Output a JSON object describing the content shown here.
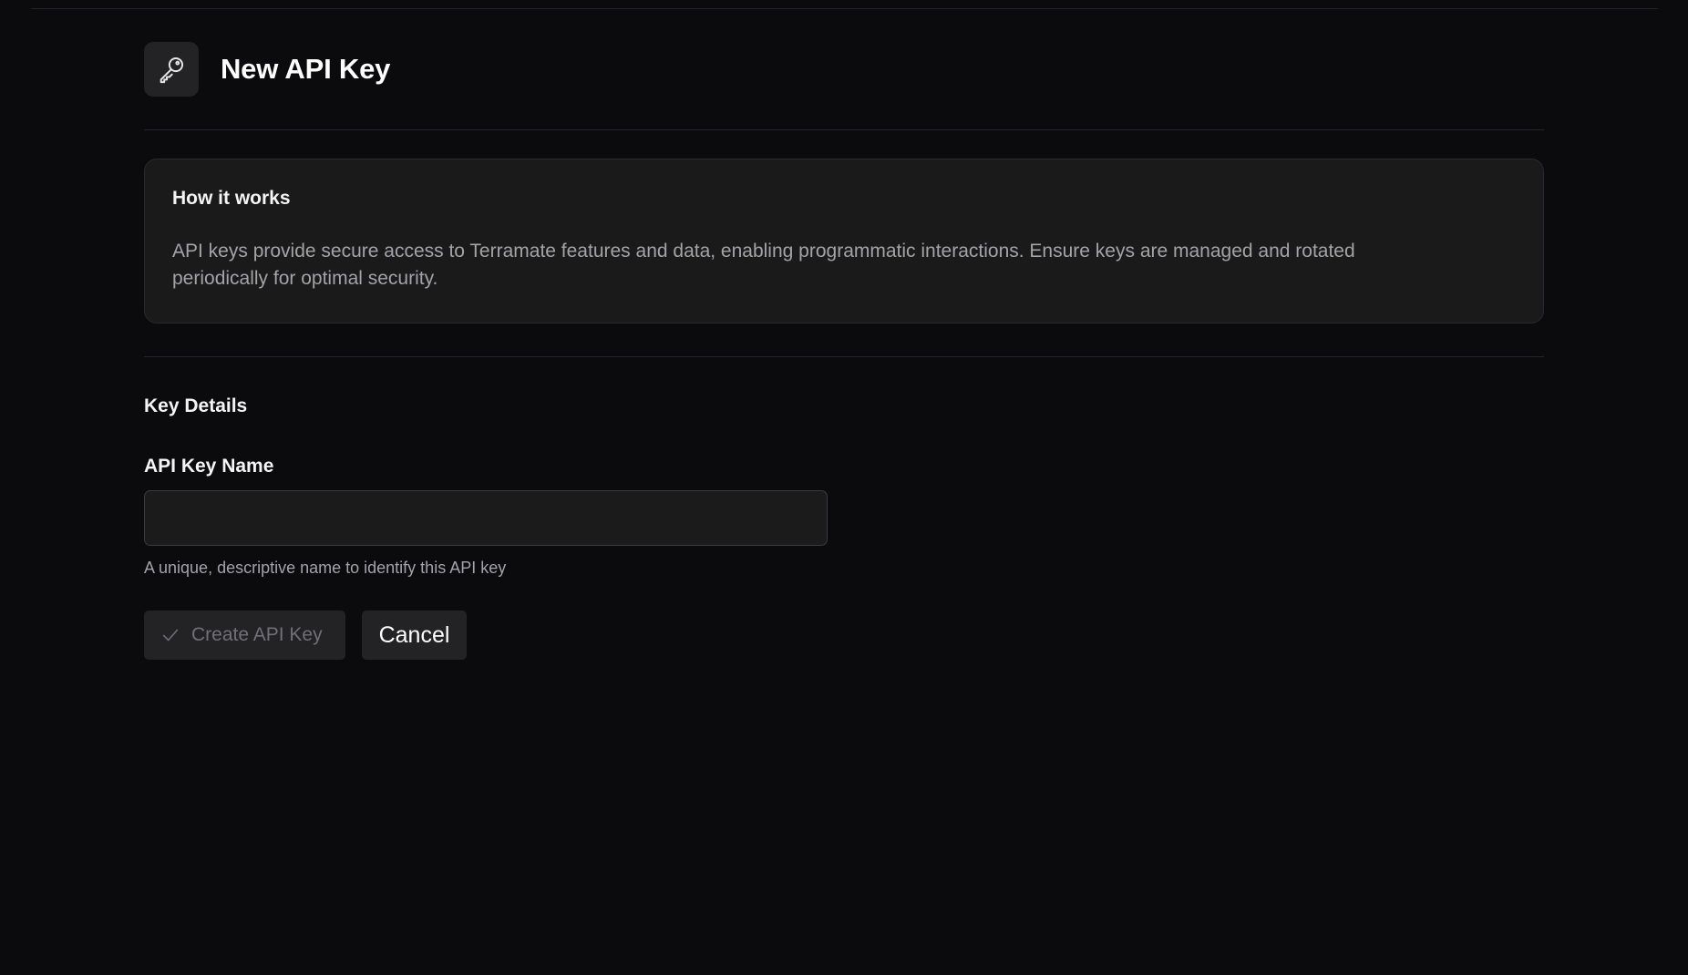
{
  "header": {
    "icon": "key-icon",
    "title": "New API Key"
  },
  "info": {
    "title": "How it works",
    "body": "API keys provide secure access to Terramate features and data, enabling programmatic interactions. Ensure keys are managed and rotated periodically for optimal security."
  },
  "section": {
    "title": "Key Details"
  },
  "form": {
    "name_label": "API Key Name",
    "name_value": "",
    "name_placeholder": "",
    "name_helper": "A unique, descriptive name to identify this API key"
  },
  "actions": {
    "create_label": "Create API Key",
    "create_icon": "check-icon",
    "create_disabled": true,
    "cancel_label": "Cancel"
  },
  "colors": {
    "background": "#0b0b0d",
    "card": "#1a1a1b",
    "muted_text": "#a3a3a8",
    "button_bg": "#232325"
  }
}
